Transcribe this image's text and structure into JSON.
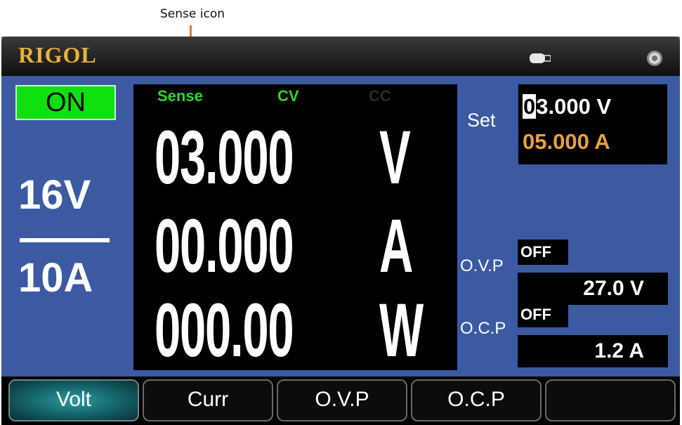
{
  "annotation": {
    "label": "Sense icon"
  },
  "header": {
    "brand": "RIGOL",
    "icons": [
      "usb-icon",
      "beep-icon"
    ]
  },
  "output": {
    "state": "ON"
  },
  "range": {
    "voltage": "16V",
    "current": "10A"
  },
  "indicators": {
    "sense": "Sense",
    "cv": "CV",
    "cc": "CC"
  },
  "readings": {
    "voltage": "03.000",
    "voltage_unit": "V",
    "current": "00.000",
    "current_unit": "A",
    "power": "000.00",
    "power_unit": "W"
  },
  "set": {
    "label": "Set",
    "voltage_cursor": "0",
    "voltage_rest": "3.000 V",
    "current": "05.000 A"
  },
  "ovp": {
    "label": "O.V.P",
    "state": "OFF",
    "value": "27.0 V"
  },
  "ocp": {
    "label": "O.C.P",
    "state": "OFF",
    "value": "1.2 A"
  },
  "softkeys": [
    "Volt",
    "Curr",
    "O.V.P",
    "O.C.P",
    ""
  ],
  "colors": {
    "panel": "#3b5aa2",
    "brand": "#e8b23a",
    "on_green": "#10e010",
    "indicator_green": "#2ed62e",
    "set_current": "#e8a13a",
    "annotation": "#e07a26"
  }
}
